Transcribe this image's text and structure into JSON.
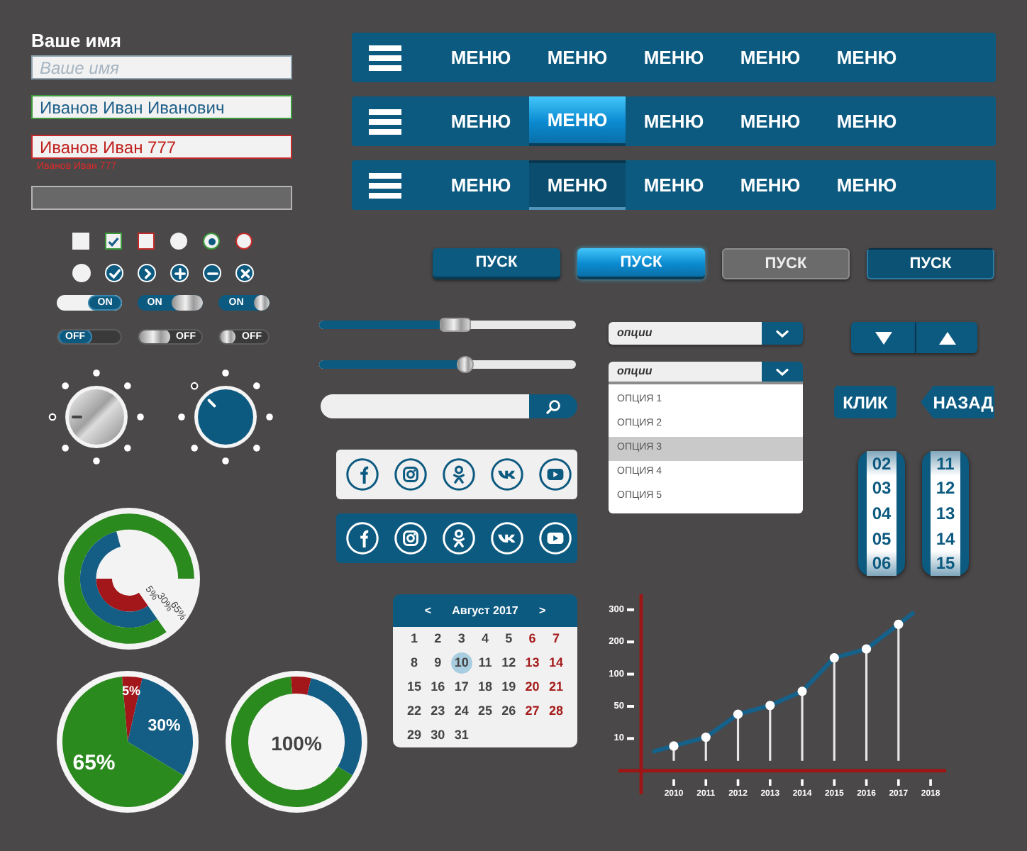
{
  "menu_bars": [
    {
      "items": [
        {
          "label": "МЕНЮ",
          "hovered": false,
          "pressed": false
        },
        {
          "label": "МЕНЮ",
          "hovered": false,
          "pressed": false
        },
        {
          "label": "МЕНЮ",
          "hovered": false,
          "pressed": false
        },
        {
          "label": "МЕНЮ",
          "hovered": false,
          "pressed": false
        },
        {
          "label": "МЕНЮ",
          "hovered": false,
          "pressed": false
        }
      ]
    },
    {
      "items": [
        {
          "label": "МЕНЮ",
          "hovered": false,
          "pressed": false
        },
        {
          "label": "МЕНЮ",
          "hovered": true,
          "pressed": false
        },
        {
          "label": "МЕНЮ",
          "hovered": false,
          "pressed": false
        },
        {
          "label": "МЕНЮ",
          "hovered": false,
          "pressed": false
        },
        {
          "label": "МЕНЮ",
          "hovered": false,
          "pressed": false
        }
      ]
    },
    {
      "items": [
        {
          "label": "МЕНЮ",
          "hovered": false,
          "pressed": false
        },
        {
          "label": "МЕНЮ",
          "hovered": false,
          "pressed": true
        },
        {
          "label": "МЕНЮ",
          "hovered": false,
          "pressed": false
        },
        {
          "label": "МЕНЮ",
          "hovered": false,
          "pressed": false
        },
        {
          "label": "МЕНЮ",
          "hovered": false,
          "pressed": false
        }
      ]
    }
  ],
  "name_form": {
    "label": "Ваше имя",
    "fields": [
      {
        "kind": "plain",
        "placeholder": "Ваше имя",
        "disabled": false
      },
      {
        "kind": "valid",
        "value": "Иванов Иван Иванович",
        "disabled": false
      },
      {
        "kind": "error",
        "value": "Иванов Иван 777",
        "disabled": false,
        "error_text": "Иванов Иван 777"
      },
      {
        "kind": "plain",
        "disabled": true
      }
    ]
  },
  "start_buttons": [
    {
      "label": "ПУСК",
      "hovered": false,
      "pressed": false,
      "disabled": false
    },
    {
      "label": "ПУСК",
      "hovered": true,
      "pressed": false,
      "disabled": false
    },
    {
      "label": "ПУСК",
      "hovered": false,
      "pressed": false,
      "disabled": true
    },
    {
      "label": "ПУСК",
      "hovered": false,
      "pressed": true,
      "disabled": false
    }
  ],
  "choices": [
    {
      "kind": "checkbox",
      "checked": false
    },
    {
      "kind": "checkbox",
      "checked": true
    },
    {
      "kind": "invalid_checkbox",
      "checked": false
    },
    {
      "kind": "radio",
      "selected": false
    },
    {
      "kind": "radio",
      "selected": true
    },
    {
      "kind": "invalid_radio",
      "selected": false
    }
  ],
  "toggles": [
    {
      "kind": "flat",
      "on": true,
      "label": "ON"
    },
    {
      "kind": "metal",
      "on": true,
      "label": "ON"
    },
    {
      "kind": "mini",
      "on": true,
      "label": "ON"
    },
    {
      "kind": "flat",
      "on": false,
      "label": "OFF"
    },
    {
      "kind": "metal",
      "on": false,
      "label": "OFF"
    },
    {
      "kind": "mini",
      "on": false,
      "label": "OFF"
    }
  ],
  "sliders": [
    {
      "kind": "bar",
      "level": 0.53
    },
    {
      "kind": "round",
      "level": 0.57
    }
  ],
  "dropdowns": [
    {
      "value": "опции",
      "expanded": false
    },
    {
      "value": "опции",
      "expanded": true,
      "options": [
        {
          "label": "ОПЦИЯ 1",
          "selected": false
        },
        {
          "label": "ОПЦИЯ 2",
          "selected": false
        },
        {
          "label": "ОПЦИЯ 3",
          "selected": true
        },
        {
          "label": "ОПЦИЯ 4",
          "selected": false
        },
        {
          "label": "ОПЦИЯ 5",
          "selected": false
        }
      ]
    }
  ],
  "knobs": [
    {
      "kind": "metal",
      "steps": [
        {
          "selected": false
        },
        {
          "selected": false
        },
        {
          "selected": false
        },
        {
          "selected": false
        },
        {
          "selected": false
        },
        {
          "selected": false
        },
        {
          "selected": true
        },
        {
          "selected": false
        }
      ]
    },
    {
      "kind": "blue",
      "steps": [
        {
          "selected": false
        },
        {
          "selected": false
        },
        {
          "selected": false
        },
        {
          "selected": false
        },
        {
          "selected": false
        },
        {
          "selected": false
        },
        {
          "selected": false
        },
        {
          "selected": true
        }
      ]
    }
  ],
  "social_panels": [
    {
      "kind": "light"
    },
    {
      "kind": "dark"
    }
  ],
  "action_buttons": [
    {
      "kind": "plain",
      "label": "КЛИК"
    },
    {
      "kind": "back",
      "label": "НАЗАД"
    }
  ],
  "number_pickers": [
    {
      "values": [
        "02",
        "03",
        "04",
        "05",
        "06"
      ]
    },
    {
      "values": [
        "11",
        "12",
        "13",
        "14",
        "15"
      ]
    }
  ],
  "radial_chart": {
    "rings": [
      {
        "label": "5%",
        "color": "#a3161a"
      },
      {
        "label": "30%",
        "color": "#145d85"
      },
      {
        "label": "65%",
        "color": "#2b8a1e"
      }
    ]
  },
  "calendar": {
    "prev": "<",
    "title": "Август 2017",
    "next": ">",
    "days": [
      {
        "label": "1",
        "weekend": false,
        "selected": false
      },
      {
        "label": "2",
        "weekend": false,
        "selected": false
      },
      {
        "label": "3",
        "weekend": false,
        "selected": false
      },
      {
        "label": "4",
        "weekend": false,
        "selected": false
      },
      {
        "label": "5",
        "weekend": false,
        "selected": false
      },
      {
        "label": "6",
        "weekend": true,
        "selected": false
      },
      {
        "label": "7",
        "weekend": true,
        "selected": false
      },
      {
        "label": "8",
        "weekend": false,
        "selected": false
      },
      {
        "label": "9",
        "weekend": false,
        "selected": false
      },
      {
        "label": "10",
        "weekend": false,
        "selected": true
      },
      {
        "label": "11",
        "weekend": false,
        "selected": false
      },
      {
        "label": "12",
        "weekend": false,
        "selected": false
      },
      {
        "label": "13",
        "weekend": true,
        "selected": false
      },
      {
        "label": "14",
        "weekend": true,
        "selected": false
      },
      {
        "label": "15",
        "weekend": false,
        "selected": false
      },
      {
        "label": "16",
        "weekend": false,
        "selected": false
      },
      {
        "label": "17",
        "weekend": false,
        "selected": false
      },
      {
        "label": "18",
        "weekend": false,
        "selected": false
      },
      {
        "label": "19",
        "weekend": false,
        "selected": false
      },
      {
        "label": "20",
        "weekend": true,
        "selected": false
      },
      {
        "label": "21",
        "weekend": true,
        "selected": false
      },
      {
        "label": "22",
        "weekend": false,
        "selected": false
      },
      {
        "label": "23",
        "weekend": false,
        "selected": false
      },
      {
        "label": "24",
        "weekend": false,
        "selected": false
      },
      {
        "label": "25",
        "weekend": false,
        "selected": false
      },
      {
        "label": "26",
        "weekend": false,
        "selected": false
      },
      {
        "label": "27",
        "weekend": true,
        "selected": false
      },
      {
        "label": "28",
        "weekend": true,
        "selected": false
      },
      {
        "label": "29",
        "weekend": false,
        "selected": false
      },
      {
        "label": "30",
        "weekend": false,
        "selected": false
      },
      {
        "label": "31",
        "weekend": false,
        "selected": false
      }
    ]
  },
  "line_chart": {
    "y_labels": [
      "300",
      "200",
      "100",
      "50",
      "10"
    ],
    "x_labels": [
      "2010",
      "2011",
      "2012",
      "2013",
      "2014",
      "2015",
      "2016",
      "2017",
      "2018"
    ]
  },
  "pie_chart": {
    "chart_data": {
      "type": "pie",
      "values": [
        5,
        30,
        65
      ],
      "value_labels": [
        "5%",
        "30%",
        "65%"
      ],
      "colors": [
        "#a3161a",
        "#145d85",
        "#2b8a1e"
      ]
    }
  },
  "donut_chart": {
    "chart_data": {
      "type": "donut",
      "values": [
        5,
        30,
        65
      ],
      "colors": [
        "#a3161a",
        "#145d85",
        "#2b8a1e"
      ],
      "annotations": [
        "100%"
      ]
    }
  }
}
